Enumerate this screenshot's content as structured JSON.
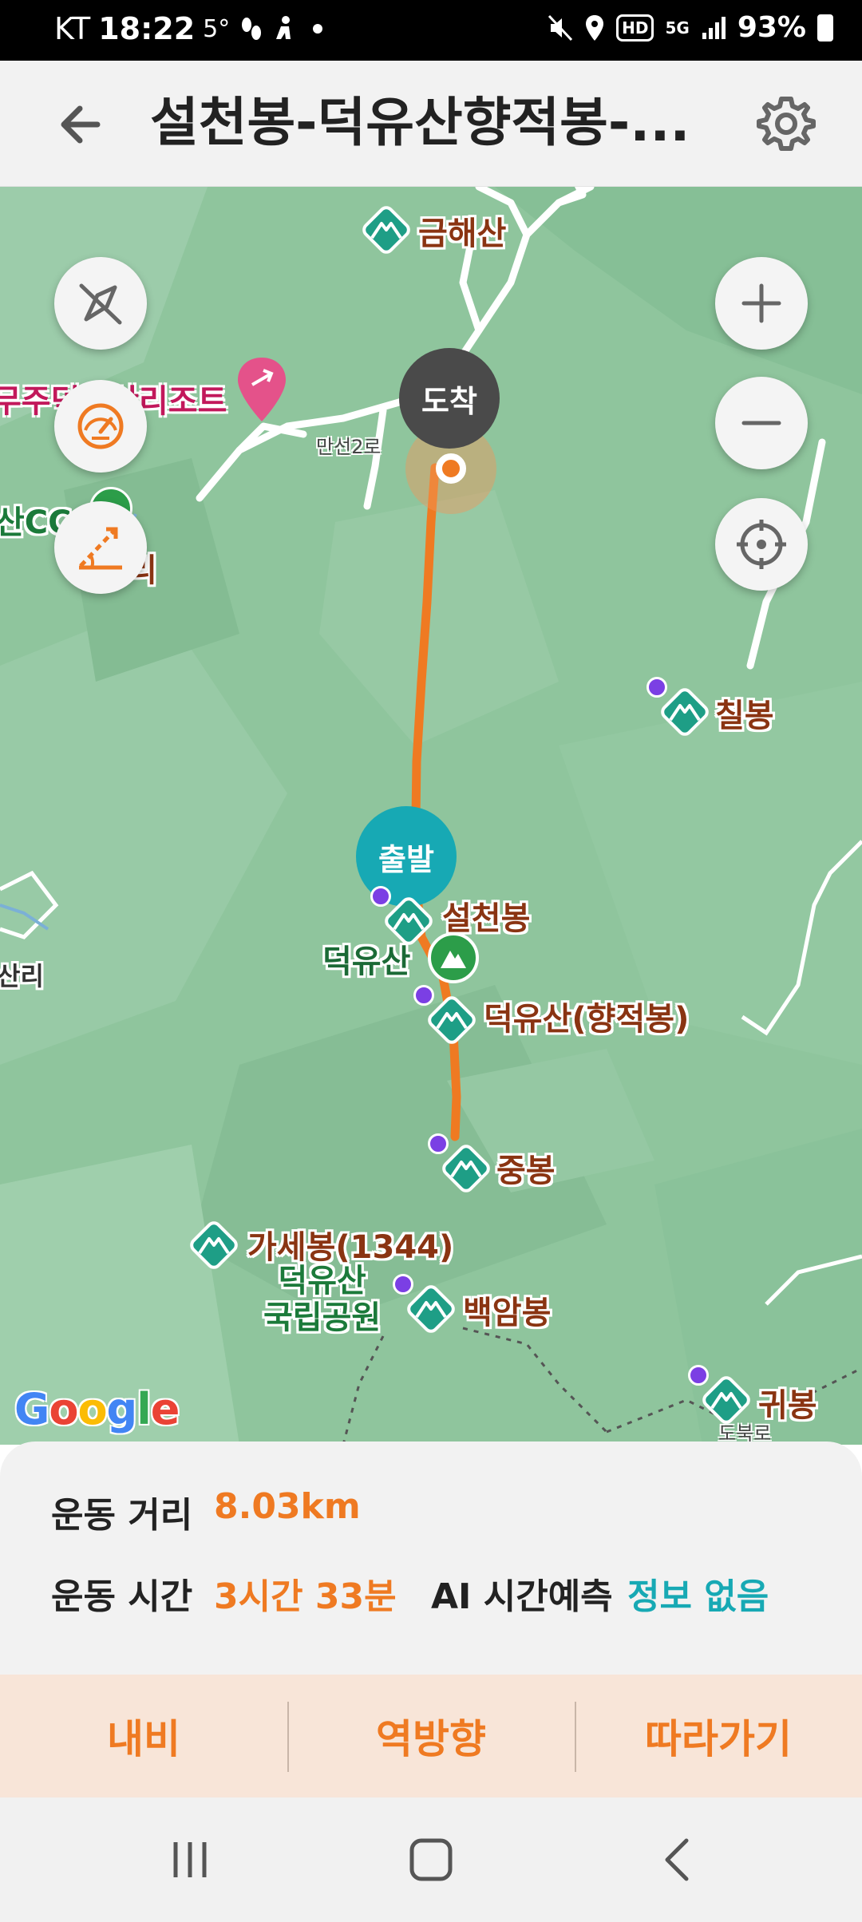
{
  "status_bar": {
    "carrier": "KT",
    "time": "18:22",
    "temperature": "5°",
    "network": "5G",
    "hd": "HD",
    "battery": "93%"
  },
  "app_bar": {
    "title": "설천봉-덕유산향적봉-..."
  },
  "map": {
    "markers": {
      "arrival": "도착",
      "departure": "출발"
    },
    "peaks": [
      "금해산",
      "칠봉",
      "설천봉",
      "덕유산(향적봉)",
      "중봉",
      "가세봉(1344)",
      "백암봉",
      "귀봉"
    ],
    "places": {
      "park": "덕유산\n국립공원",
      "deogyusan": "덕유산",
      "resort": "무주덕유산리조트",
      "road": "만선2로",
      "village": "산리",
      "partial_cc": "산CC",
      "partial_dong": "리",
      "partial_bottom": "도북로"
    },
    "route_color": "#ef7a22",
    "google": "Google"
  },
  "info_panel": {
    "distance_label": "운동 거리",
    "distance_value": "8.03km",
    "time_label": "운동 시간",
    "time_value": "3시간 33분",
    "ai_label": "AI 시간예측",
    "ai_value": "정보 없음"
  },
  "actions": {
    "navigate": "내비",
    "reverse": "역방향",
    "follow": "따라가기"
  }
}
